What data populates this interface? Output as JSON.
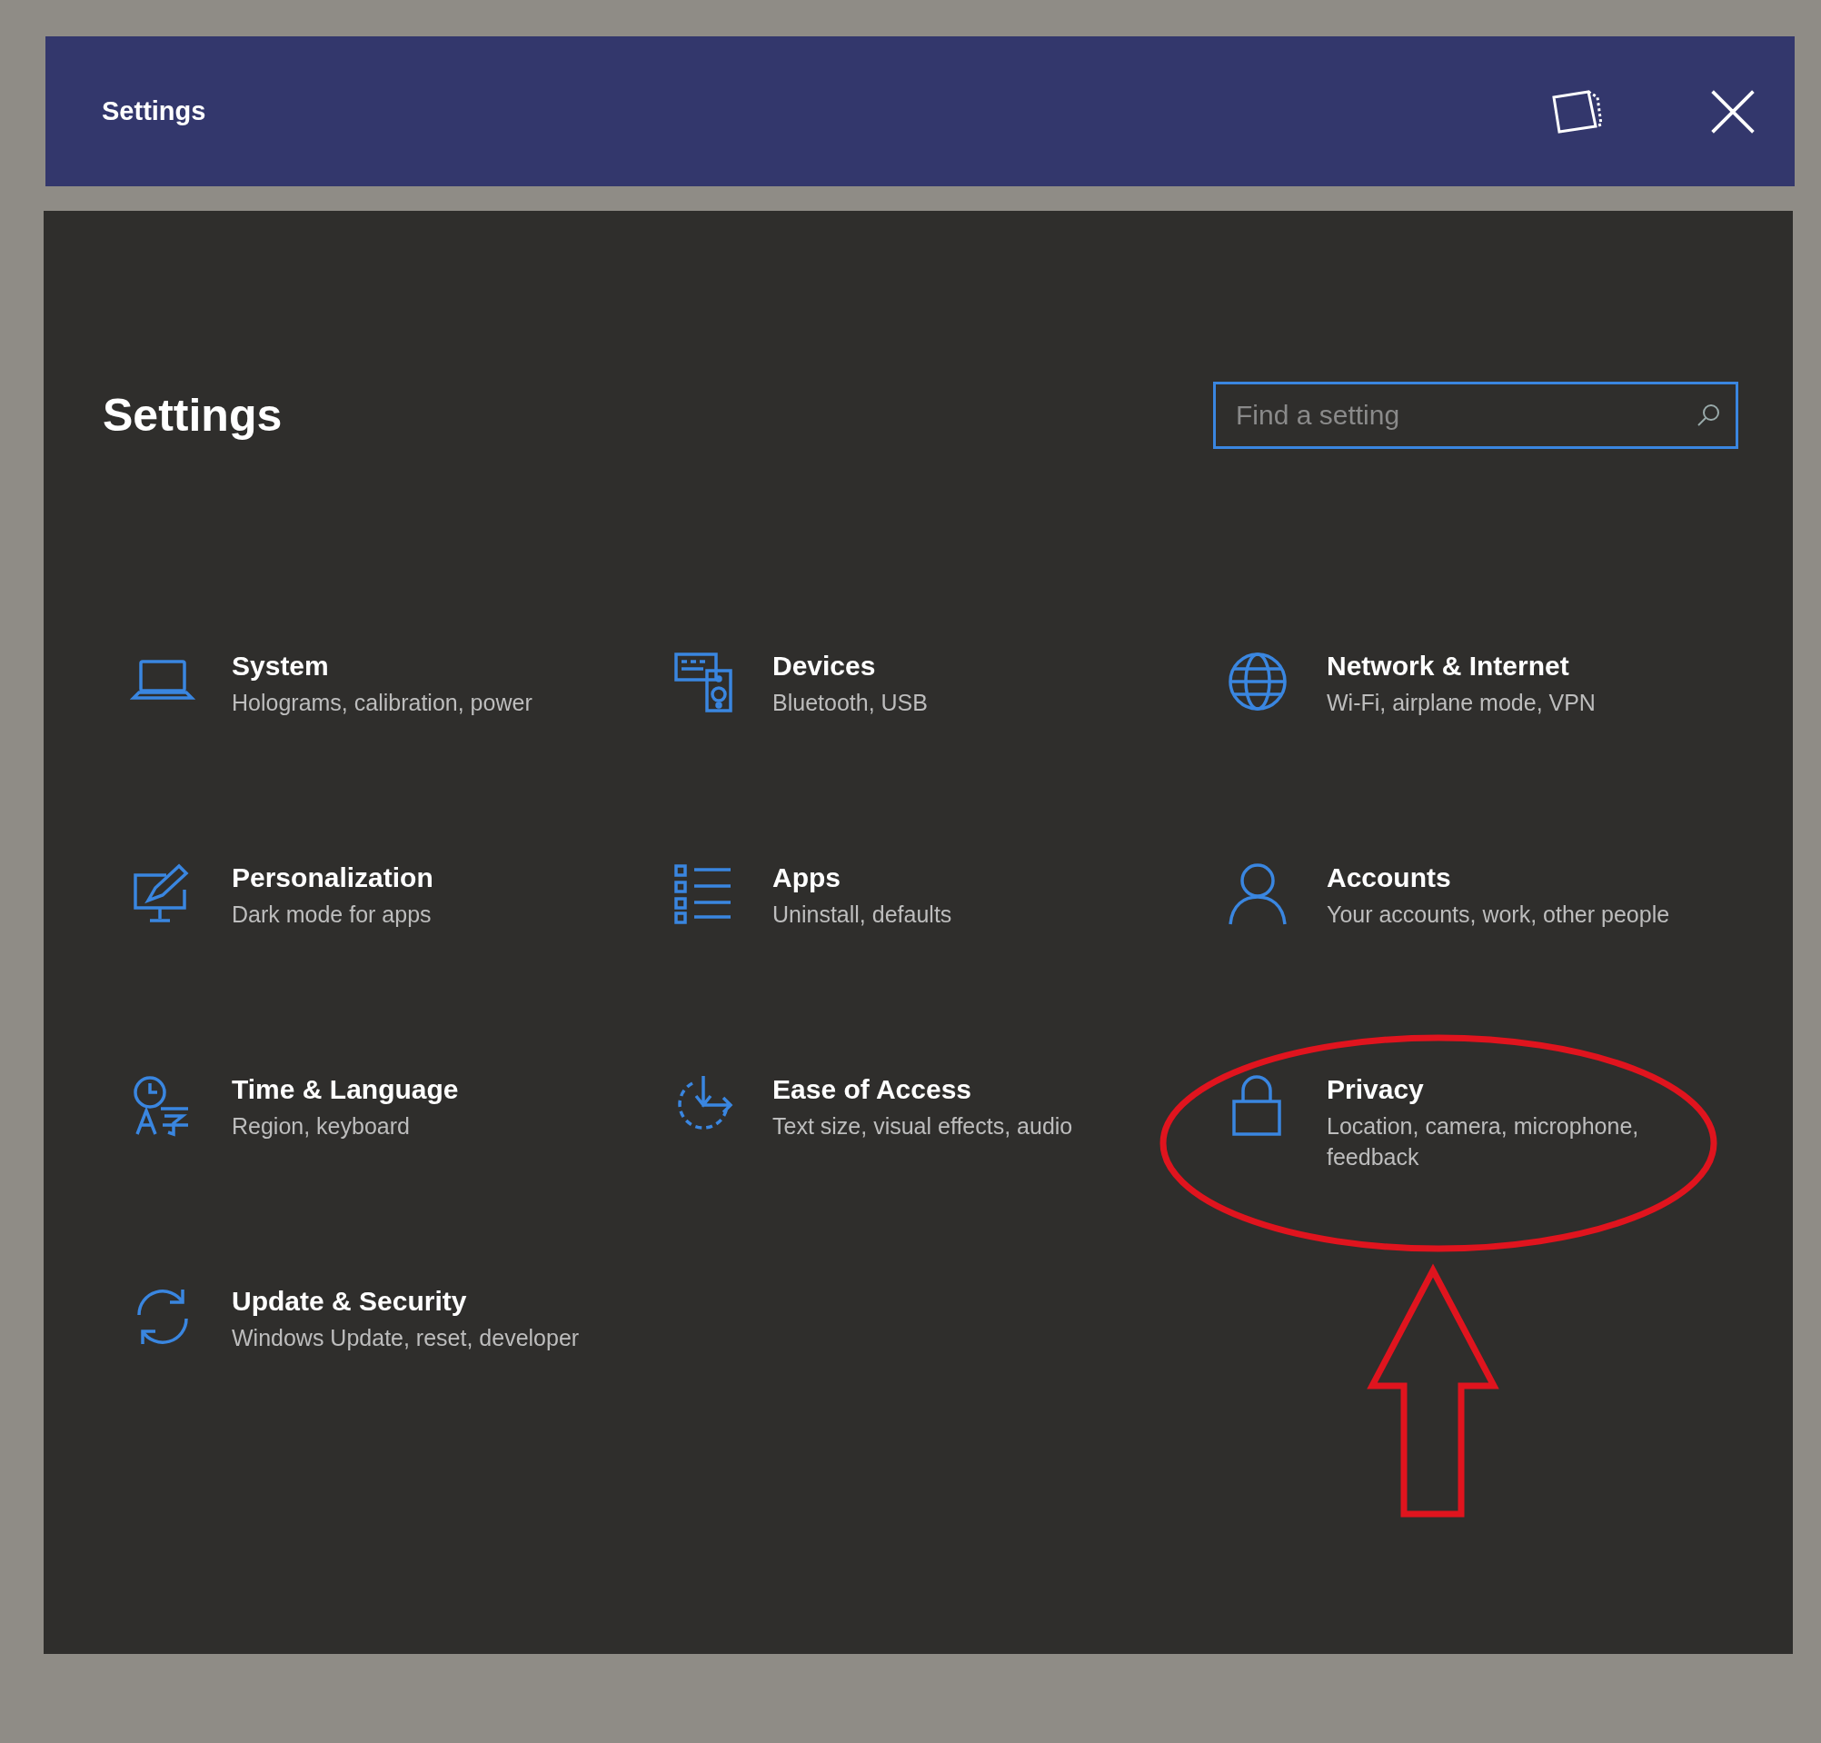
{
  "window": {
    "title": "Settings"
  },
  "page": {
    "heading": "Settings"
  },
  "search": {
    "placeholder": "Find a setting"
  },
  "categories": [
    {
      "kind": "laptop",
      "title": "System",
      "subtitle": "Holograms, calibration, power"
    },
    {
      "kind": "devices",
      "title": "Devices",
      "subtitle": "Bluetooth, USB"
    },
    {
      "kind": "globe",
      "title": "Network & Internet",
      "subtitle": "Wi-Fi, airplane mode, VPN"
    },
    {
      "kind": "paint",
      "title": "Personalization",
      "subtitle": "Dark mode for apps"
    },
    {
      "kind": "list",
      "title": "Apps",
      "subtitle": "Uninstall, defaults"
    },
    {
      "kind": "person",
      "title": "Accounts",
      "subtitle": "Your accounts, work, other people"
    },
    {
      "kind": "language",
      "title": "Time & Language",
      "subtitle": "Region, keyboard"
    },
    {
      "kind": "access",
      "title": "Ease of Access",
      "subtitle": "Text size, visual effects, audio"
    },
    {
      "kind": "lock",
      "title": "Privacy",
      "subtitle": "Location, camera, microphone, feedback"
    },
    {
      "kind": "sync",
      "title": "Update & Security",
      "subtitle": "Windows Update, reset, developer"
    }
  ]
}
